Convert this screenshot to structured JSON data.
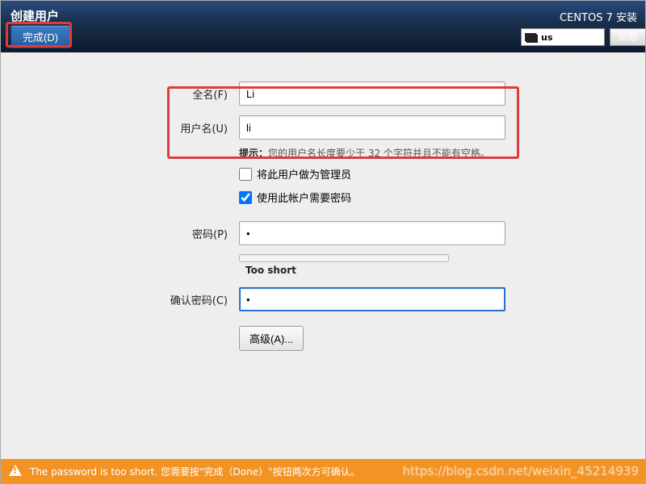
{
  "header": {
    "title": "创建用户",
    "done_label": "完成(D)",
    "install_label": "CENTOS 7 安装",
    "keyboard_layout": "us",
    "help_label": "帮助"
  },
  "form": {
    "fullname_label": "全名(F)",
    "fullname_value": "Li",
    "username_label": "用户名(U)",
    "username_value": "li",
    "hint_prefix": "提示：",
    "hint_text": "您的用户名长度要少于 32 个字符并且不能有空格。",
    "admin_label": "将此用户做为管理员",
    "admin_checked": false,
    "require_pw_label": "使用此帐户需要密码",
    "require_pw_checked": true,
    "password_label": "密码(P)",
    "password_value": "•",
    "strength_text": "Too short",
    "confirm_label": "确认密码(C)",
    "confirm_value": "•",
    "advanced_label": "高级(A)..."
  },
  "warning": {
    "message": "The password is too short. 您需要按\"完成（Done）\"按钮两次方可确认。"
  },
  "watermark": "https://blog.csdn.net/weixin_45214939"
}
